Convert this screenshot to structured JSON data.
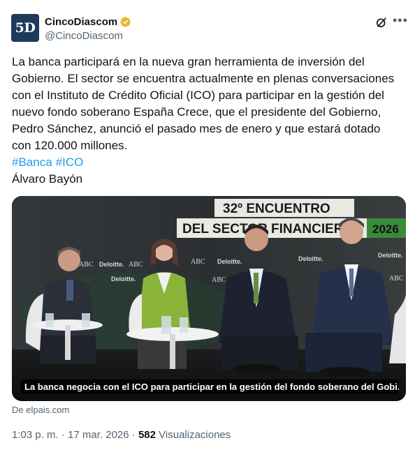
{
  "account": {
    "avatar_text": "5D",
    "name": "CincoDiascom",
    "handle": "@CincoDiascom"
  },
  "icons": {
    "verified": "verified-badge-icon",
    "grok": "grok-icon",
    "more": "more-icon"
  },
  "tweet": {
    "text": "La banca participará en la nueva gran herramienta de inversión del\nGobierno. El sector se encuentra actualmente en plenas conversaciones\ncon el Instituto de Crédito Oficial (ICO) para participar en la gestión del\nnuevo fondo soberano España Crece, que el presidente del Gobierno,\nPedro Sánchez, anunció el pasado mes de enero y que estará dotado\ncon 120.000 millones.",
    "hashtags": [
      "#Banca",
      "#ICO"
    ],
    "author": "Álvaro Bayón"
  },
  "card": {
    "caption": "La banca negocia con el ICO para participar en la gestión del fondo soberano del Gobi...",
    "backdrop_lines": [
      "32º ENCUENTRO",
      "DEL SECTOR FINANCIERO",
      "2026"
    ],
    "logos": [
      "ABC",
      "Deloitte."
    ],
    "source": "De elpais.com"
  },
  "meta": {
    "time": "1:03 p. m.",
    "separator": "·",
    "date": "17 mar. 2026",
    "views_count": "582",
    "views_label": "Visualizaciones"
  },
  "colors": {
    "link": "#1d9bf0",
    "secondary_text": "#536471",
    "verified": "#e8b626"
  }
}
